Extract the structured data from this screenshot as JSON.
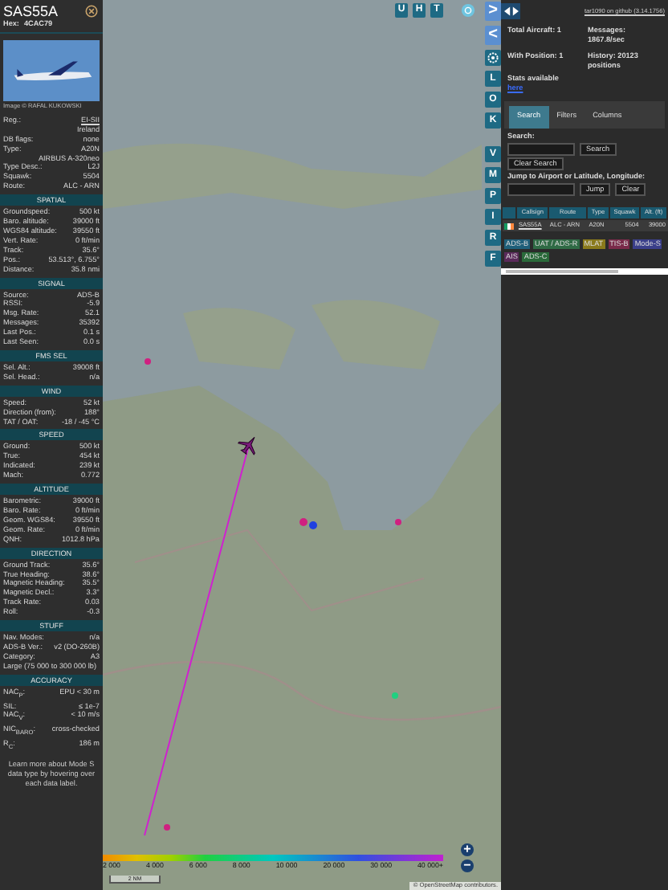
{
  "aircraft_panel": {
    "callsign": "SAS55A",
    "hex_label": "Hex:",
    "hex": "4CAC79",
    "photo_credit": "Image © RAFAL KUKOWSKI",
    "details": [
      {
        "label": "Reg.:",
        "value": "EI-SII",
        "kind": "link"
      },
      {
        "value": "Ireland",
        "kind": "plain"
      },
      {
        "label": "DB flags:",
        "value": "none",
        "kind": "plain"
      },
      {
        "label": "Type:",
        "value": "A20N",
        "kind": "plain"
      },
      {
        "value": "AIRBUS A-320neo",
        "kind": "plain"
      },
      {
        "label": "Type Desc.:",
        "value": "L2J",
        "kind": "plain"
      },
      {
        "label": "Squawk:",
        "value": "5504",
        "kind": "plain"
      },
      {
        "label": "Route:",
        "value": "ALC - ARN",
        "kind": "plain"
      }
    ],
    "sections": [
      {
        "title": "SPATIAL",
        "rows": [
          {
            "label": "Groundspeed:",
            "value": "500 kt"
          },
          {
            "label": "Baro. altitude:",
            "value": "39000 ft"
          },
          {
            "label": "WGS84 altitude:",
            "value": "39550 ft"
          },
          {
            "label": "Vert. Rate:",
            "value": "0 ft/min"
          },
          {
            "label": "Track:",
            "value": "35.6°"
          },
          {
            "label": "Pos.:",
            "value": "53.513°, 6.755°"
          },
          {
            "label": "Distance:",
            "value": "35.8 nmi"
          }
        ]
      },
      {
        "title": "SIGNAL",
        "rows": [
          {
            "label": "Source:",
            "value": "ADS-B"
          },
          {
            "label": "RSSI:",
            "value": "-5.9"
          },
          {
            "label": "Msg. Rate:",
            "value": "52.1"
          },
          {
            "label": "Messages:",
            "value": "35392"
          },
          {
            "label": "Last Pos.:",
            "value": "0.1 s"
          },
          {
            "label": "Last Seen:",
            "value": "0.0 s"
          }
        ]
      },
      {
        "title": "FMS SEL",
        "rows": [
          {
            "label": "Sel. Alt.:",
            "value": "39008 ft"
          },
          {
            "label": "Sel. Head.:",
            "value": "n/a"
          }
        ]
      },
      {
        "title": "WIND",
        "rows": [
          {
            "label": "Speed:",
            "value": "52 kt"
          },
          {
            "label": "Direction (from):",
            "value": "188°"
          },
          {
            "label": "TAT / OAT:",
            "value": "-18 / -45 °C"
          }
        ]
      },
      {
        "title": "SPEED",
        "rows": [
          {
            "label": "Ground:",
            "value": "500 kt"
          },
          {
            "label": "True:",
            "value": "454 kt"
          },
          {
            "label": "Indicated:",
            "value": "239 kt"
          },
          {
            "label": "Mach:",
            "value": "0.772"
          }
        ]
      },
      {
        "title": "ALTITUDE",
        "rows": [
          {
            "label": "Barometric:",
            "value": "39000 ft"
          },
          {
            "label": "Baro. Rate:",
            "value": "0 ft/min"
          },
          {
            "label": "Geom. WGS84:",
            "value": "39550 ft"
          },
          {
            "label": "Geom. Rate:",
            "value": "0 ft/min"
          },
          {
            "label": "QNH:",
            "value": "1012.8 hPa"
          }
        ]
      },
      {
        "title": "DIRECTION",
        "rows": [
          {
            "label": "Ground Track:",
            "value": "35.6°"
          },
          {
            "label": "True Heading:",
            "value": "38.6°"
          },
          {
            "label": "Magnetic Heading:",
            "value": "35.5°"
          },
          {
            "label": "Magnetic Decl.:",
            "value": "3.3°"
          },
          {
            "label": "Track Rate:",
            "value": "0.03"
          },
          {
            "label": "Roll:",
            "value": "-0.3"
          }
        ]
      },
      {
        "title": "STUFF",
        "rows": [
          {
            "label": "Nav. Modes:",
            "value": "n/a"
          },
          {
            "label": "ADS-B Ver.:",
            "value": "v2 (DO-260B)"
          },
          {
            "label": "Category:",
            "value": "A3"
          },
          {
            "value": "Large (75 000 to 300 000 lb)"
          }
        ]
      },
      {
        "title": "ACCURACY",
        "rows": [
          {
            "label": "NAC$_{P}$:",
            "value": "EPU < 30 m"
          },
          {
            "label": "SIL:",
            "value": "≤ 1e-7"
          },
          {
            "label": "NAC$_{V}$:",
            "value": "< 10 m/s"
          },
          {
            "label": "NIC$_{BARO}$:",
            "value": "cross-checked"
          },
          {
            "label": "R$_{C}$:",
            "value": "186 m"
          }
        ]
      }
    ],
    "footer": "Learn more about Mode S data type by hovering over each data label."
  },
  "map": {
    "top_buttons": [
      "U",
      "H",
      "T"
    ],
    "side_buttons": [
      {
        "label": ">",
        "kind": "text"
      },
      {
        "label": "<",
        "kind": "text"
      },
      {
        "kind": "gear"
      },
      {
        "label": "L",
        "kind": "text"
      },
      {
        "label": "O",
        "kind": "text"
      },
      {
        "label": "K",
        "kind": "text"
      },
      {
        "label": "V",
        "kind": "text"
      },
      {
        "label": "M",
        "kind": "text"
      },
      {
        "label": "P",
        "kind": "text"
      },
      {
        "label": "I",
        "kind": "text"
      },
      {
        "label": "R",
        "kind": "text"
      },
      {
        "label": "F",
        "kind": "text"
      }
    ],
    "altitude_legend": [
      "2 000",
      "4 000",
      "6 000",
      "8 000",
      "10 000",
      "20 000",
      "30 000",
      "40 000+"
    ],
    "scale": "2 NM",
    "attribution": "© OpenStreetMap contributors.",
    "zoom_buttons": [
      "+",
      "−"
    ]
  },
  "list_panel": {
    "version_link": "tar1090 on github (3.14.1756)",
    "stats": [
      {
        "label": "Total Aircraft:",
        "value": "1"
      },
      {
        "label": "Messages:",
        "value": "1867.8/sec"
      },
      {
        "label": "With Position:",
        "value": "1"
      },
      {
        "label": "History:",
        "value": "20123 positions"
      }
    ],
    "stats_text": "Stats available",
    "stats_link": "here",
    "tabs": [
      {
        "label": "Search",
        "selected": true
      },
      {
        "label": "Filters",
        "selected": false
      },
      {
        "label": "Columns",
        "selected": false
      }
    ],
    "search_label": "Search:",
    "search_button": "Search",
    "clear_search_button": "Clear Search",
    "jump_label": "Jump to Airport or Latitude, Longitude:",
    "jump_button": "Jump",
    "clear_button": "Clear",
    "table": {
      "columns": [
        "Callsign",
        "Route",
        "Type",
        "Squawk",
        "Alt. (ft)"
      ],
      "rows": [
        {
          "callsign": "SAS55A",
          "route": "ALC - ARN",
          "type": "A20N",
          "squawk": "5504",
          "altitude": "39000"
        }
      ]
    },
    "source_tags": [
      {
        "label": "ADS-B",
        "color": "#1f5f7a"
      },
      {
        "label": "UAT / ADS-R",
        "color": "#2f6b45"
      },
      {
        "label": "MLAT",
        "color": "#8a7a1c"
      },
      {
        "label": "TIS-B",
        "color": "#7a2a4a"
      },
      {
        "label": "Mode-S",
        "color": "#3a3f8a"
      },
      {
        "label": "AIS",
        "color": "#5a2a5a"
      },
      {
        "label": "ADS-C",
        "color": "#2a6a3a"
      }
    ]
  }
}
